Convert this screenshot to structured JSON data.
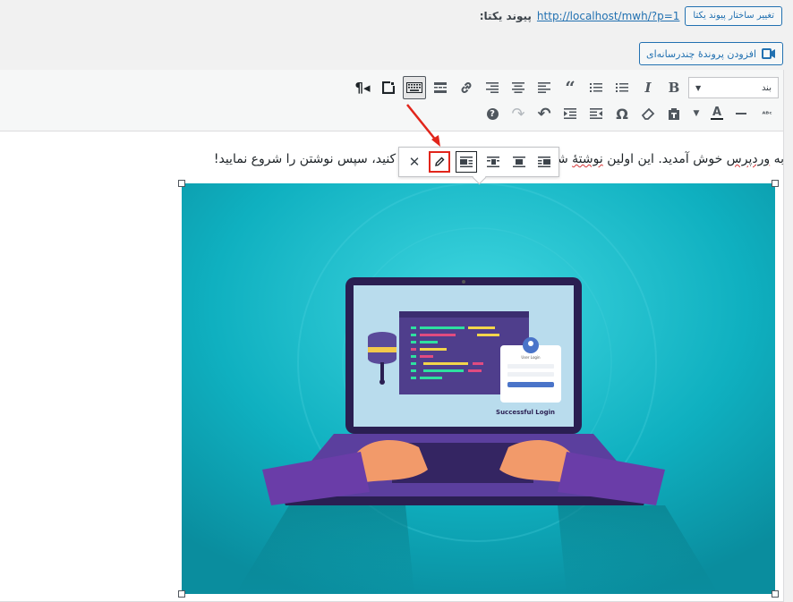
{
  "permalink": {
    "label": "پیوند یکتا:",
    "url": "http://localhost/mwh/?p=1",
    "change_button": "تغییر ساختار پیوند یکتا"
  },
  "add_media": {
    "label": "افزودن پروندهٔ چندرسانه‌ای",
    "icon": "media-icon"
  },
  "toolbar": {
    "format_select": "بند",
    "row1_icons": [
      "bold-icon",
      "italic-icon",
      "bulleted-list-icon",
      "numbered-list-icon",
      "blockquote-icon",
      "align-left-icon",
      "align-center-icon",
      "align-right-icon",
      "link-icon",
      "read-more-icon",
      "toolbar-toggle-icon",
      "distraction-free-icon",
      "paragraph-direction-icon"
    ],
    "row2_icons": [
      "strikethrough-icon",
      "horizontal-line-icon",
      "text-color-icon",
      "paste-as-text-icon",
      "clear-formatting-icon",
      "special-character-icon",
      "decrease-indent-icon",
      "increase-indent-icon",
      "undo-icon",
      "redo-icon",
      "help-icon"
    ]
  },
  "content": {
    "text_before": "به ",
    "text_misspelled_1": "وردپرس",
    "text_middle": " خوش آمدید. این اولین ",
    "text_misspelled_2": "نوشتهٔ",
    "text_after": " شماست. این را ویرایش یا حذف کنید، سپس نوشتن را شروع نمایید!"
  },
  "image": {
    "caption_text": "Successful Login",
    "login_title": "User Login"
  },
  "image_toolbar": {
    "icons": [
      "close-icon",
      "edit-pencil-icon",
      "align-left-icon",
      "align-center-icon",
      "align-right-icon",
      "align-none-icon"
    ]
  },
  "colors": {
    "accent": "#2271b1",
    "highlight": "#e1251b",
    "image_bg": "#0fb0c0"
  }
}
